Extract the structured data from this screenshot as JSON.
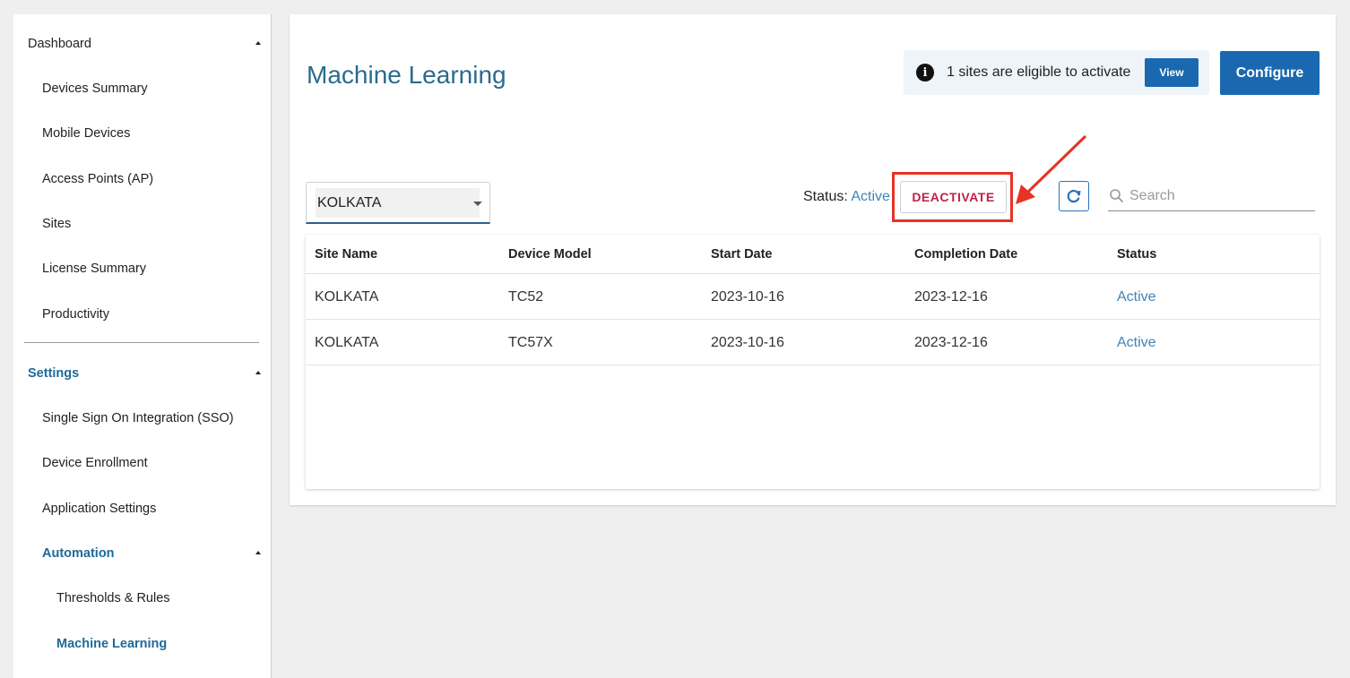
{
  "sidebar": {
    "items": [
      {
        "label": "Dashboard"
      },
      {
        "label": "Devices Summary"
      },
      {
        "label": "Mobile Devices"
      },
      {
        "label": "Access Points (AP)"
      },
      {
        "label": "Sites"
      },
      {
        "label": "License Summary"
      },
      {
        "label": "Productivity"
      },
      {
        "label": "Settings"
      },
      {
        "label": "Single Sign On Integration (SSO)"
      },
      {
        "label": "Device Enrollment"
      },
      {
        "label": "Application Settings"
      },
      {
        "label": "Automation"
      },
      {
        "label": "Thresholds & Rules"
      },
      {
        "label": "Machine Learning"
      }
    ]
  },
  "main": {
    "title": "Machine Learning",
    "banner": {
      "text": "1 sites are eligible to activate",
      "view_label": "View",
      "icon": "info-icon"
    },
    "configure_label": "Configure",
    "site_select": {
      "value": "KOLKATA"
    },
    "status": {
      "label": "Status:",
      "value": "Active"
    },
    "deactivate_label": "DEACTIVATE",
    "search": {
      "placeholder": "Search"
    },
    "table": {
      "columns": [
        "Site Name",
        "Device Model",
        "Start Date",
        "Completion Date",
        "Status"
      ],
      "rows": [
        [
          "KOLKATA",
          "TC52",
          "2023-10-16",
          "2023-12-16",
          "Active"
        ],
        [
          "KOLKATA",
          "TC57X",
          "2023-10-16",
          "2023-12-16",
          "Active"
        ]
      ]
    }
  },
  "colors": {
    "accent": "#1a69b0",
    "title": "#2b6b8e",
    "active_text": "#3f84b8",
    "danger": "#c2204a",
    "annotation": "#e63323"
  }
}
